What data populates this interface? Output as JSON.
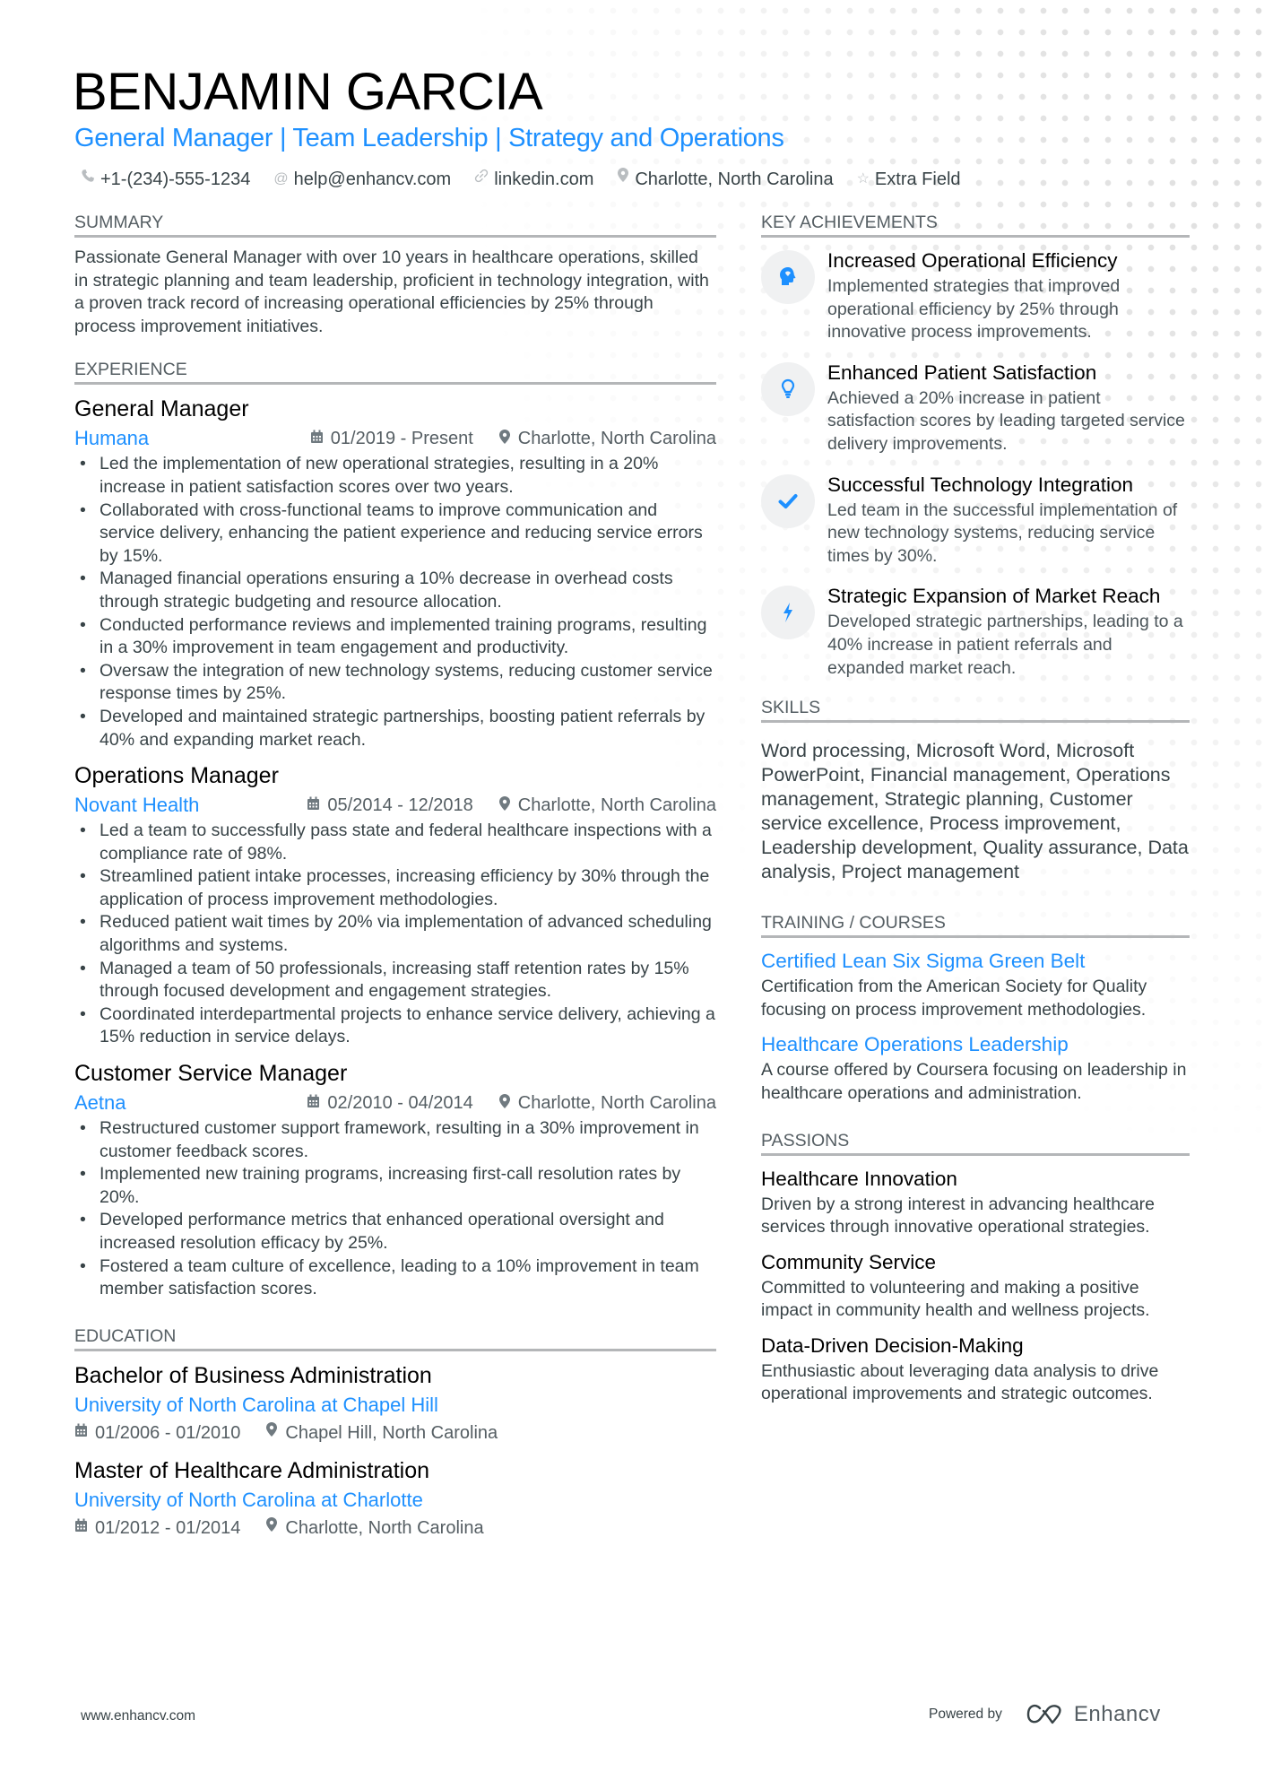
{
  "header": {
    "name": "BENJAMIN GARCIA",
    "headline": "General Manager | Team Leadership | Strategy and Operations",
    "contacts": [
      {
        "icon": "phone-icon",
        "glyph": "☎",
        "text": "+1-(234)-555-1234"
      },
      {
        "icon": "at-icon",
        "glyph": "@",
        "text": "help@enhancv.com"
      },
      {
        "icon": "link-icon",
        "glyph": "∞",
        "text": "linkedin.com"
      },
      {
        "icon": "location-pin-icon",
        "glyph": "◉",
        "text": "Charlotte, North Carolina"
      },
      {
        "icon": "star-icon",
        "glyph": "☆",
        "text": "Extra Field"
      }
    ]
  },
  "summary": {
    "title": "SUMMARY",
    "text": "Passionate General Manager with over 10 years in healthcare operations, skilled in strategic planning and team leadership, proficient in technology integration, with a proven track record of increasing operational efficiencies by 25% through process improvement initiatives."
  },
  "experience": {
    "title": "EXPERIENCE",
    "items": [
      {
        "role": "General Manager",
        "company": "Humana",
        "dates": "01/2019 - Present",
        "location": "Charlotte, North Carolina",
        "bullets": [
          "Led the implementation of new operational strategies, resulting in a 20% increase in patient satisfaction scores over two years.",
          "Collaborated with cross-functional teams to improve communication and service delivery, enhancing the patient experience and reducing service errors by 15%.",
          "Managed financial operations ensuring a 10% decrease in overhead costs through strategic budgeting and resource allocation.",
          "Conducted performance reviews and implemented training programs, resulting in a 30% improvement in team engagement and productivity.",
          "Oversaw the integration of new technology systems, reducing customer service response times by 25%.",
          "Developed and maintained strategic partnerships, boosting patient referrals by 40% and expanding market reach."
        ]
      },
      {
        "role": "Operations Manager",
        "company": "Novant Health",
        "dates": "05/2014 - 12/2018",
        "location": "Charlotte, North Carolina",
        "bullets": [
          "Led a team to successfully pass state and federal healthcare inspections with a compliance rate of 98%.",
          "Streamlined patient intake processes, increasing efficiency by 30% through the application of process improvement methodologies.",
          "Reduced patient wait times by 20% via implementation of advanced scheduling algorithms and systems.",
          "Managed a team of 50 professionals, increasing staff retention rates by 15% through focused development and engagement strategies.",
          "Coordinated interdepartmental projects to enhance service delivery, achieving a 15% reduction in service delays."
        ]
      },
      {
        "role": "Customer Service Manager",
        "company": "Aetna",
        "dates": "02/2010 - 04/2014",
        "location": "Charlotte, North Carolina",
        "bullets": [
          "Restructured customer support framework, resulting in a 30% improvement in customer feedback scores.",
          "Implemented new training programs, increasing first-call resolution rates by 20%.",
          "Developed performance metrics that enhanced operational oversight and increased resolution efficacy by 25%.",
          "Fostered a team culture of excellence, leading to a 10% improvement in team member satisfaction scores."
        ]
      }
    ]
  },
  "education": {
    "title": "EDUCATION",
    "items": [
      {
        "degree": "Bachelor of Business Administration",
        "school": "University of North Carolina at Chapel Hill",
        "dates": "01/2006 - 01/2010",
        "location": "Chapel Hill, North Carolina"
      },
      {
        "degree": "Master of Healthcare Administration",
        "school": "University of North Carolina at Charlotte",
        "dates": "01/2012 - 01/2014",
        "location": "Charlotte, North Carolina"
      }
    ]
  },
  "achievements": {
    "title": "KEY ACHIEVEMENTS",
    "items": [
      {
        "icon": "brain-head-icon",
        "title": "Increased Operational Efficiency",
        "desc": "Implemented strategies that improved operational efficiency by 25% through innovative process improvements."
      },
      {
        "icon": "lightbulb-icon",
        "title": "Enhanced Patient Satisfaction",
        "desc": "Achieved a 20% increase in patient satisfaction scores by leading targeted service delivery improvements."
      },
      {
        "icon": "checkmark-icon",
        "title": "Successful Technology Integration",
        "desc": "Led team in the successful implementation of new technology systems, reducing service times by 30%."
      },
      {
        "icon": "lightning-bolt-icon",
        "title": "Strategic Expansion of Market Reach",
        "desc": "Developed strategic partnerships, leading to a 40% increase in patient referrals and expanded market reach."
      }
    ]
  },
  "skills": {
    "title": "SKILLS",
    "text": "Word processing, Microsoft Word, Microsoft PowerPoint, Financial management, Operations management, Strategic planning, Customer service excellence, Process improvement, Leadership development, Quality assurance, Data analysis, Project management"
  },
  "training": {
    "title": "TRAINING / COURSES",
    "items": [
      {
        "title": "Certified Lean Six Sigma Green Belt",
        "desc": "Certification from the American Society for Quality focusing on process improvement methodologies."
      },
      {
        "title": "Healthcare Operations Leadership",
        "desc": "A course offered by Coursera focusing on leadership in healthcare operations and administration."
      }
    ]
  },
  "passions": {
    "title": "PASSIONS",
    "items": [
      {
        "title": "Healthcare Innovation",
        "desc": "Driven by a strong interest in advancing healthcare services through innovative operational strategies."
      },
      {
        "title": "Community Service",
        "desc": "Committed to volunteering and making a positive impact in community health and wellness projects."
      },
      {
        "title": "Data-Driven Decision-Making",
        "desc": "Enthusiastic about leveraging data analysis to drive operational improvements and strategic outcomes."
      }
    ]
  },
  "footer": {
    "website": "www.enhancv.com",
    "powered_by": "Powered by",
    "brand": "Enhancv"
  },
  "colors": {
    "accent": "#1e90ff",
    "text": "#384347",
    "divider": "#b4b6b8",
    "icon_circle": "#f0f1f2"
  }
}
